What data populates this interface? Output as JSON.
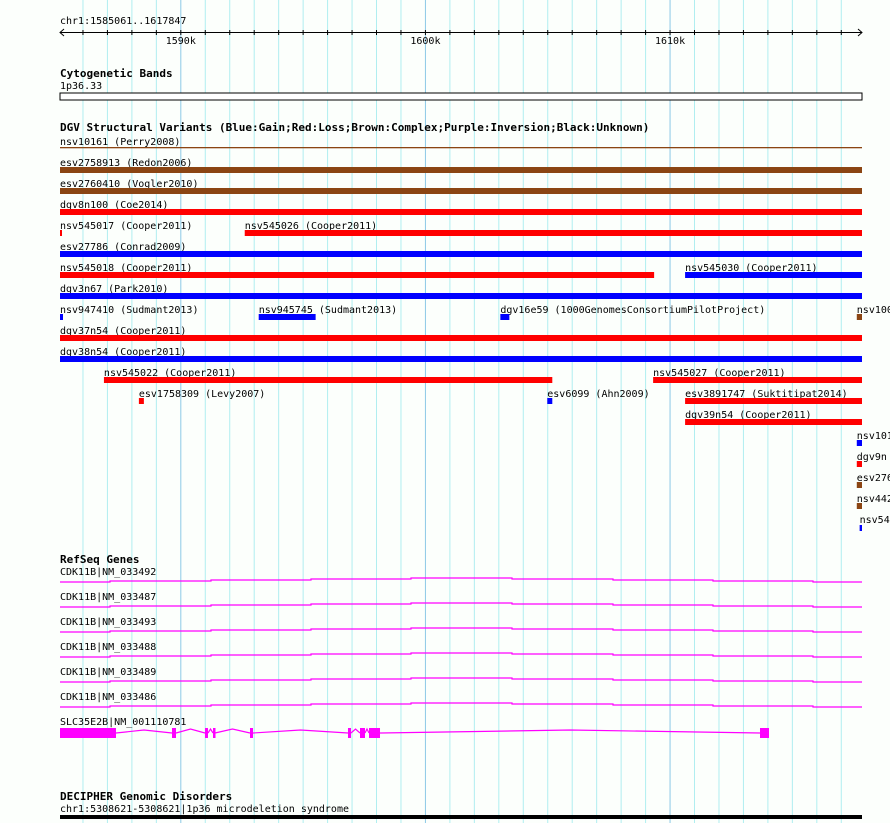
{
  "colors": {
    "gain": "#0000ff",
    "loss": "#ff0000",
    "complex": "#8b4513",
    "grid": "#b0eef0",
    "grid_major": "#8cc8e6",
    "gene": "#ff00ff",
    "black": "#000000"
  },
  "ruler": {
    "label": "chr1:1585061..1617847",
    "start": 1585061,
    "end": 1617847,
    "tick_labels": [
      {
        "pos": 1590000,
        "text": "1590k"
      },
      {
        "pos": 1600000,
        "text": "1600k"
      },
      {
        "pos": 1610000,
        "text": "1610k"
      }
    ]
  },
  "cytoband": {
    "title": "Cytogenetic Bands",
    "label": "1p36.33"
  },
  "dgv": {
    "title": "DGV Structural Variants (Blue:Gain;Red:Loss;Brown:Complex;Purple:Inversion;Black:Unknown)",
    "rows": [
      [
        {
          "id": "nsv10161",
          "study": "Perry2008",
          "type": "complex",
          "start": 1585061,
          "end": 1617847,
          "thin": true
        }
      ],
      [
        {
          "id": "esv2758913",
          "study": "Redon2006",
          "type": "complex",
          "start": 1585061,
          "end": 1617847
        }
      ],
      [
        {
          "id": "esv2760410",
          "study": "Vogler2010",
          "type": "complex",
          "start": 1585061,
          "end": 1617847
        }
      ],
      [
        {
          "id": "dgv8n100",
          "study": "Coe2014",
          "type": "loss",
          "start": 1585061,
          "end": 1617847
        }
      ],
      [
        {
          "id": "nsv545017",
          "study": "Cooper2011",
          "type": "loss",
          "start": 1585061,
          "end": 1585100
        },
        {
          "id": "nsv545026",
          "study": "Cooper2011",
          "type": "loss",
          "start": 1592613,
          "end": 1617847
        }
      ],
      [
        {
          "id": "esv27786",
          "study": "Conrad2009",
          "type": "gain",
          "start": 1585061,
          "end": 1617847
        }
      ],
      [
        {
          "id": "nsv545018",
          "study": "Cooper2011",
          "type": "loss",
          "start": 1585061,
          "end": 1609349
        },
        {
          "id": "nsv545030",
          "study": "Cooper2011",
          "type": "gain",
          "start": 1610615,
          "end": 1617847
        }
      ],
      [
        {
          "id": "dgv3n67",
          "study": "Park2010",
          "type": "gain",
          "start": 1585061,
          "end": 1617847
        }
      ],
      [
        {
          "id": "nsv947410",
          "study": "Sudmant2013",
          "type": "gain",
          "start": 1585061,
          "end": 1585184
        },
        {
          "id": "nsv945745",
          "study": "Sudmant2013",
          "type": "gain",
          "start": 1593184,
          "end": 1595511
        },
        {
          "id": "dgv16e59",
          "study": "1000GenomesConsortiumPilotProject",
          "type": "gain",
          "start": 1603063,
          "end": 1603430
        },
        {
          "id": "nsv100",
          "study": "",
          "type": "complex",
          "start": 1617634,
          "end": 1617847,
          "truncated": true
        }
      ],
      [
        {
          "id": "dgv37n54",
          "study": "Cooper2011",
          "type": "loss",
          "start": 1585061,
          "end": 1617847
        }
      ],
      [
        {
          "id": "dgv38n54",
          "study": "Cooper2011",
          "type": "gain",
          "start": 1585061,
          "end": 1617847
        }
      ],
      [
        {
          "id": "nsv545022",
          "study": "Cooper2011",
          "type": "loss",
          "start": 1586857,
          "end": 1605186
        },
        {
          "id": "nsv545027",
          "study": "Cooper2011",
          "type": "loss",
          "start": 1609308,
          "end": 1617847
        }
      ],
      [
        {
          "id": "esv1758309",
          "study": "Levy2007",
          "type": "loss",
          "start": 1588286,
          "end": 1588490
        },
        {
          "id": "esv6099",
          "study": "Ahn2009",
          "type": "gain",
          "start": 1604981,
          "end": 1605186
        },
        {
          "id": "esv3891747",
          "study": "Suktitipat2014",
          "type": "loss",
          "start": 1610615,
          "end": 1617847
        }
      ],
      [
        {
          "id": "dgv39n54",
          "study": "Cooper2011",
          "type": "loss",
          "start": 1610615,
          "end": 1617847
        }
      ],
      [
        {
          "id": "nsv101",
          "study": "",
          "type": "gain",
          "start": 1617634,
          "end": 1617847,
          "truncated": true
        }
      ],
      [
        {
          "id": "dgv9n",
          "study": "",
          "type": "loss",
          "start": 1617634,
          "end": 1617847,
          "truncated": true
        }
      ],
      [
        {
          "id": "esv276",
          "study": "",
          "type": "complex",
          "start": 1617634,
          "end": 1617847,
          "truncated": true
        }
      ],
      [
        {
          "id": "nsv442",
          "study": "",
          "type": "complex",
          "start": 1617634,
          "end": 1617847,
          "truncated": true
        }
      ],
      [
        {
          "id": "nsv54",
          "study": "",
          "type": "gain",
          "start": 1617750,
          "end": 1617847,
          "truncated": true,
          "thin": true
        }
      ]
    ]
  },
  "refseq": {
    "title": "RefSeq Genes",
    "genes": [
      {
        "label": "CDK11B|NM_033492",
        "exons": []
      },
      {
        "label": "CDK11B|NM_033487",
        "exons": []
      },
      {
        "label": "CDK11B|NM_033493",
        "exons": []
      },
      {
        "label": "CDK11B|NM_033488",
        "exons": []
      },
      {
        "label": "CDK11B|NM_033489",
        "exons": []
      },
      {
        "label": "CDK11B|NM_033486",
        "exons": []
      },
      {
        "label": "SLC35E2B|NM_001110781",
        "start": 1585061,
        "end": 1614045,
        "exons": [
          [
            1585061,
            1587350
          ],
          [
            1589640,
            1589803
          ],
          [
            1590989,
            1591111
          ],
          [
            1591316,
            1591397
          ],
          [
            1592828,
            1592951
          ],
          [
            1596834,
            1596957
          ],
          [
            1597325,
            1597529
          ],
          [
            1597693,
            1598143
          ],
          [
            1613677,
            1614045
          ]
        ]
      }
    ]
  },
  "decipher": {
    "title": "DECIPHER Genomic Disorders",
    "label": "chr1:5308621-5308621|1p36 microdeletion syndrome"
  }
}
